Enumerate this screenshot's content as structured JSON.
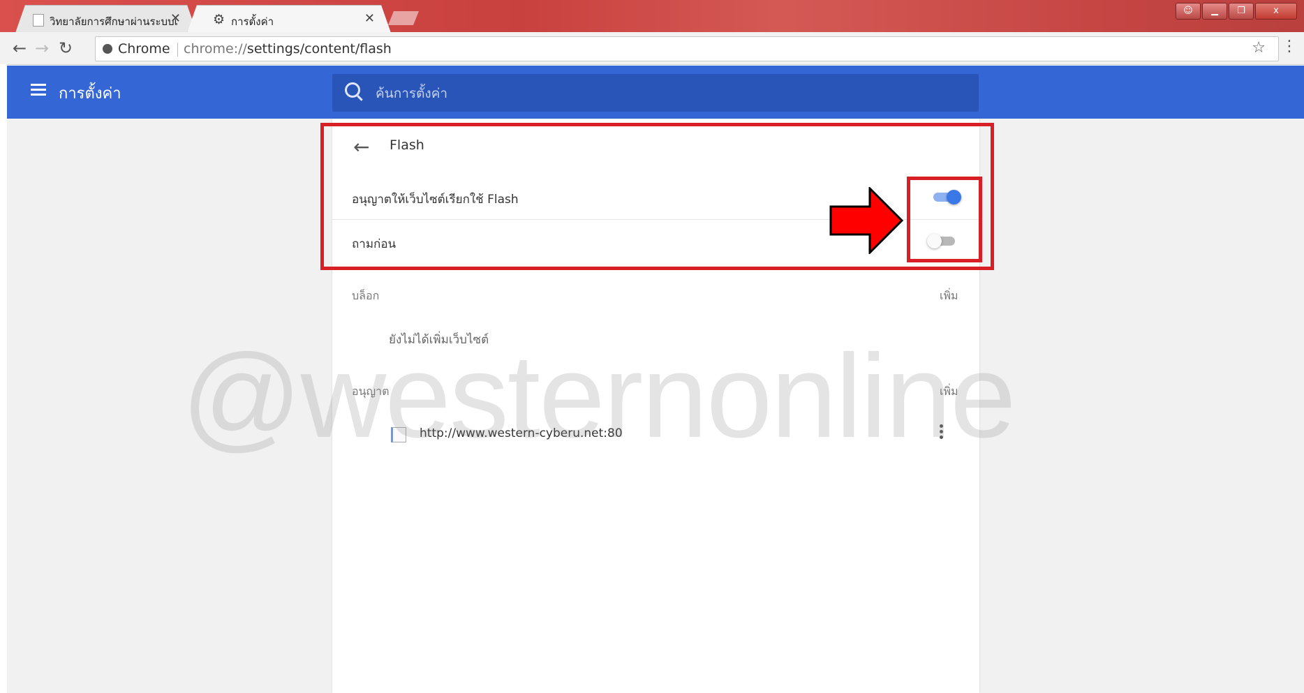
{
  "tabs": [
    {
      "title": "วิทยาลัยการศึกษาผ่านระบบเ",
      "active": false
    },
    {
      "title": "การตั้งค่า",
      "active": true
    }
  ],
  "window_controls": {
    "close": "x"
  },
  "toolbar": {
    "chip_label": "Chrome",
    "url_prefix": "chrome://",
    "url_path": "settings/content/flash"
  },
  "header": {
    "title": "การตั้งค่า",
    "search_placeholder": "ค้นการตั้งค่า"
  },
  "page": {
    "title": "Flash",
    "rows": [
      {
        "label": "อนุญาตให้เว็บไซต์เรียกใช้ Flash",
        "enabled": true
      },
      {
        "label": "ถามก่อน",
        "enabled": false
      }
    ],
    "block": {
      "label": "บล็อก",
      "add": "เพิ่ม",
      "empty": "ยังไม่ได้เพิ่มเว็บไซต์"
    },
    "allow": {
      "label": "อนุญาต",
      "add": "เพิ่ม",
      "sites": [
        "http://www.western-cyberu.net:80"
      ]
    }
  },
  "watermark": "@westernonline",
  "colors": {
    "header": "#3566d6",
    "search": "#2a55b8",
    "toggle_on": "#3b78e7",
    "annotation_red": "#d91f26",
    "arrow_red": "#ff0000"
  },
  "icons": [
    "back-arrow-icon",
    "forward-arrow-icon",
    "reload-icon",
    "star-icon",
    "menu-icon",
    "search-icon",
    "hamburger-icon",
    "kebab-icon",
    "gear-icon"
  ]
}
